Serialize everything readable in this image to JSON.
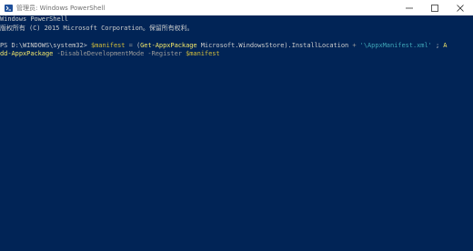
{
  "window": {
    "title": "管理员: Windows PowerShell",
    "icon": "powershell-icon",
    "controls": {
      "minimize_icon": "minimize-icon",
      "maximize_icon": "maximize-icon",
      "close_icon": "close-icon"
    }
  },
  "colors": {
    "console_background": "#012456",
    "default_text": "#cccccc",
    "variable": "#d3bd3b",
    "command": "#f2e66a",
    "parameter": "#9a9a9a",
    "string": "#3fa6b8"
  },
  "console": {
    "header_line1": "Windows PowerShell",
    "header_line2": "版权所有 (C) 2015 Microsoft Corporation。保留所有权利。",
    "prompt": "PS D:\\WINDOWS\\system32> ",
    "line3": {
      "var1": "$manifest",
      "op1": " = ",
      "paren_open": "(",
      "cmd1": "Get-AppxPackage",
      "arg1": " Microsoft.WindowsStore",
      "paren_close": ").InstallLocation",
      "op2": " + ",
      "str1": "'\\AppxManifest.xml'",
      "op3": " ; ",
      "wrap_start": "A"
    },
    "line4": {
      "cmd_rest": "dd-AppxPackage",
      "param1": " -DisableDevelopmentMode",
      "param2": " -Register",
      "space": " ",
      "var2": "$manifest"
    }
  }
}
